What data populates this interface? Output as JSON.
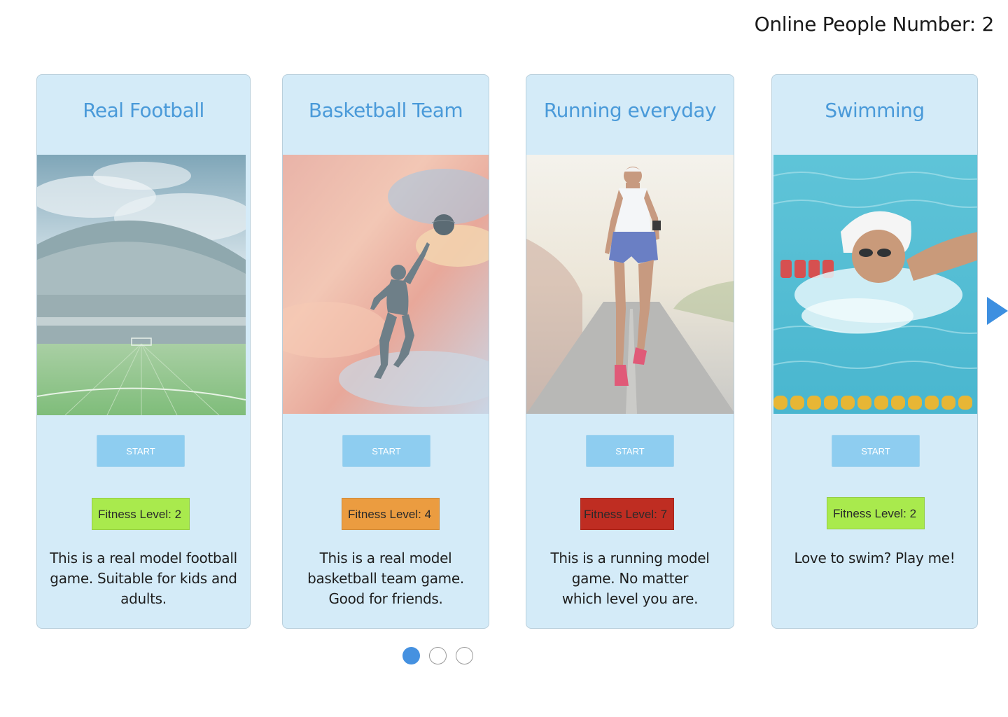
{
  "header": {
    "online_label": "Online People Number: 2"
  },
  "cards": [
    {
      "title": "Real Football",
      "start_label": "START",
      "level_label": "Fitness Level: 2",
      "level_color": "#a9ea4d",
      "description": "This is a real model football game. Suitable for kids and adults.",
      "image_icon": "stadium-image"
    },
    {
      "title": "Basketball Team",
      "start_label": "START",
      "level_label": "Fitness Level: 4",
      "level_color": "#eb9c40",
      "description": "This is a real model basketball team game. Good for friends.",
      "image_icon": "basketball-player-image"
    },
    {
      "title": "Running everyday",
      "start_label": "START",
      "level_label": "Fitness Level: 7",
      "level_color": "#bf2d22",
      "description": "This is a running model game. No matter which level you are.",
      "image_icon": "runner-image"
    },
    {
      "title": "Swimming",
      "start_label": "START",
      "level_label": "Fitness Level: 2",
      "level_color": "#a9ea4d",
      "description": "Love to swim? Play me!",
      "image_icon": "swimmer-image"
    }
  ],
  "carousel": {
    "next_icon": "play-triangle-icon",
    "page_count": 3,
    "active_page": 1
  },
  "colors": {
    "card_bg": "#d4ebf8",
    "title_color": "#4a9ad9",
    "start_bg": "#8ecdf0",
    "accent": "#4591e0"
  }
}
